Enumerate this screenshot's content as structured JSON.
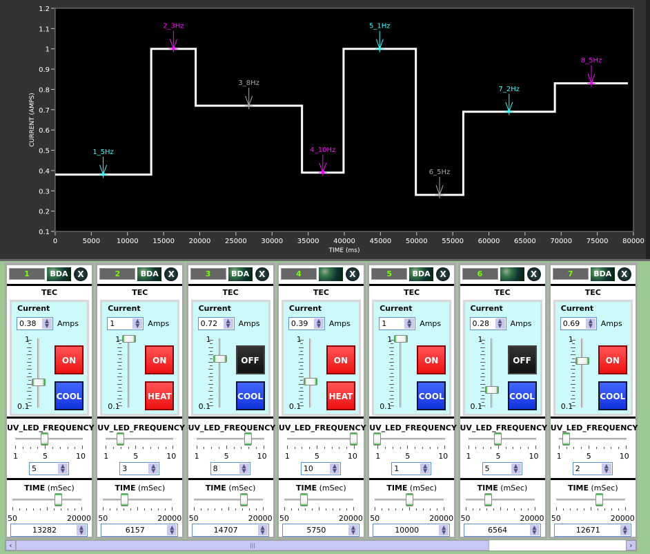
{
  "chart_data": {
    "type": "line",
    "xlabel": "TIME (ms)",
    "ylabel": "CURRENT (AMPS)",
    "xlim": [
      0,
      80000
    ],
    "ylim": [
      0.1,
      1.2
    ],
    "x_ticks": [
      "0",
      "5000",
      "10000",
      "15000",
      "20000",
      "25000",
      "30000",
      "35000",
      "40000",
      "45000",
      "50000",
      "55000",
      "60000",
      "65000",
      "70000",
      "75000",
      "80000"
    ],
    "y_ticks": [
      "0.1",
      "0.2",
      "0.3",
      "0.4",
      "0.5",
      "0.6",
      "0.7",
      "0.8",
      "0.9",
      "1",
      "1.1",
      "1.2"
    ],
    "grid": false,
    "background": "#000000",
    "line_color": "#ffffff",
    "step_edges": [
      0,
      13282,
      19439,
      34146,
      39896,
      49896,
      56460,
      69131,
      79230
    ],
    "step_values": [
      0.38,
      1,
      0.72,
      0.39,
      1,
      0.28,
      0.69,
      0.83
    ],
    "markers": [
      {
        "label": "1_5Hz",
        "x": 6641,
        "y": 0.38,
        "color": "#33ffff"
      },
      {
        "label": "2_3Hz",
        "x": 16360,
        "y": 1,
        "color": "#ff00ff"
      },
      {
        "label": "3_8Hz",
        "x": 26792,
        "y": 0.72,
        "color": "#aaaaaa"
      },
      {
        "label": "4_10Hz",
        "x": 37021,
        "y": 0.39,
        "color": "#ff00ff"
      },
      {
        "label": "5_1Hz",
        "x": 44896,
        "y": 1,
        "color": "#33ffff"
      },
      {
        "label": "6_5Hz",
        "x": 53178,
        "y": 0.28,
        "color": "#aaaaaa"
      },
      {
        "label": "7_2Hz",
        "x": 62795,
        "y": 0.69,
        "color": "#33ffff"
      },
      {
        "label": "8_5Hz",
        "x": 74180,
        "y": 0.83,
        "color": "#ff00ff"
      }
    ]
  },
  "panels": [
    {
      "number": "1",
      "badge": "BDA",
      "close": "X",
      "tec": "TEC",
      "current_label": "Current",
      "current": "0.38",
      "current_value": 0.38,
      "units": "Amps",
      "scale_max": "1",
      "scale_min": "0.1",
      "power": "ON",
      "mode": "COOL",
      "uv_label": "UV_LED_FREQUENCY",
      "freq_ticks": [
        "1",
        "5",
        "10"
      ],
      "freq": "5",
      "freq_value": 5,
      "time_label": "TIME",
      "time_unit": "(mSec)",
      "time_min": "50",
      "time_max": "20000",
      "time": "13282",
      "time_value": 13282
    },
    {
      "number": "2",
      "badge": "BDA",
      "close": "X",
      "tec": "TEC",
      "current_label": "Current",
      "current": "1",
      "current_value": 1,
      "units": "Amps",
      "scale_max": "1",
      "scale_min": "0.1",
      "power": "ON",
      "mode": "HEAT",
      "uv_label": "UV_LED_FREQUENCY",
      "freq_ticks": [
        "1",
        "5",
        "10"
      ],
      "freq": "3",
      "freq_value": 3,
      "time_label": "TIME",
      "time_unit": "(mSec)",
      "time_min": "50",
      "time_max": "20000",
      "time": "6157",
      "time_value": 6157
    },
    {
      "number": "3",
      "badge": "BDA",
      "close": "X",
      "tec": "TEC",
      "current_label": "Current",
      "current": "0.72",
      "current_value": 0.72,
      "units": "Amps",
      "scale_max": "1",
      "scale_min": "0.1",
      "power": "OFF",
      "mode": "COOL",
      "uv_label": "UV_LED_FREQUENCY",
      "freq_ticks": [
        "1",
        "5",
        "10"
      ],
      "freq": "8",
      "freq_value": 8,
      "time_label": "TIME",
      "time_unit": "(mSec)",
      "time_min": "50",
      "time_max": "20000",
      "time": "14707",
      "time_value": 14707
    },
    {
      "number": "4",
      "badge": "",
      "close": "X",
      "tec": "TEC",
      "current_label": "Current",
      "current": "0.39",
      "current_value": 0.39,
      "units": "Amps",
      "scale_max": "1",
      "scale_min": "0.1",
      "power": "ON",
      "mode": "HEAT",
      "uv_label": "UV_LED_FREQUENCY",
      "freq_ticks": [
        "1",
        "5",
        "10"
      ],
      "freq": "10",
      "freq_value": 10,
      "time_label": "TIME",
      "time_unit": "(mSec)",
      "time_min": "50",
      "time_max": "20000",
      "time": "5750",
      "time_value": 5750
    },
    {
      "number": "5",
      "badge": "BDA",
      "close": "X",
      "tec": "TEC",
      "current_label": "Current",
      "current": "1",
      "current_value": 1,
      "units": "Amps",
      "scale_max": "1",
      "scale_min": "0.1",
      "power": "ON",
      "mode": "COOL",
      "uv_label": "UV_LED_FREQUENCY",
      "freq_ticks": [
        "1",
        "5",
        "10"
      ],
      "freq": "1",
      "freq_value": 1,
      "time_label": "TIME",
      "time_unit": "(mSec)",
      "time_min": "50",
      "time_max": "20000",
      "time": "10000",
      "time_value": 10000
    },
    {
      "number": "6",
      "badge": "",
      "close": "X",
      "tec": "TEC",
      "current_label": "Current",
      "current": "0.28",
      "current_value": 0.28,
      "units": "Amps",
      "scale_max": "1",
      "scale_min": "0.1",
      "power": "OFF",
      "mode": "COOL",
      "uv_label": "UV_LED_FREQUENCY",
      "freq_ticks": [
        "1",
        "5",
        "10"
      ],
      "freq": "5",
      "freq_value": 5,
      "time_label": "TIME",
      "time_unit": "(mSec)",
      "time_min": "50",
      "time_max": "20000",
      "time": "6564",
      "time_value": 6564
    },
    {
      "number": "7",
      "badge": "BDA",
      "close": "X",
      "tec": "TEC",
      "current_label": "Current",
      "current": "0.69",
      "current_value": 0.69,
      "units": "Amps",
      "scale_max": "1",
      "scale_min": "0.1",
      "power": "ON",
      "mode": "COOL",
      "uv_label": "UV_LED_FREQUENCY",
      "freq_ticks": [
        "1",
        "5",
        "10"
      ],
      "freq": "2",
      "freq_value": 2,
      "time_label": "TIME",
      "time_unit": "(mSec)",
      "time_min": "50",
      "time_max": "20000",
      "time": "12671",
      "time_value": 12671
    }
  ],
  "scrollbar": {
    "left_icon": "chevron-left-icon",
    "right_icon": "chevron-right-icon",
    "grip": "|||",
    "position": 0.0,
    "visible_fraction": 0.76
  },
  "colors": {
    "on": "#ee1111",
    "off": "#111111",
    "cool": "#1133dd",
    "heat": "#ee1111",
    "digit": "#77ff00",
    "tec_bg": "#ccfafa"
  }
}
